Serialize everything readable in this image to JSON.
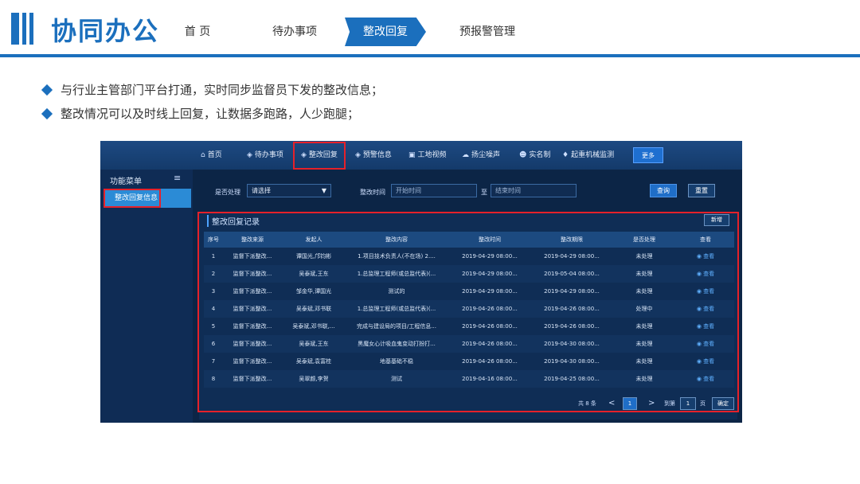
{
  "slide": {
    "title": "协同办公",
    "nav": [
      {
        "label": "首 页"
      },
      {
        "label": "待办事项"
      },
      {
        "label": "整改回复"
      },
      {
        "label": "预报警管理"
      }
    ],
    "bullets": [
      "与行业主管部门平台打通，实时同步监督员下发的整改信息；",
      "整改情况可以及时线上回复，让数据多跑路，人少跑腿；"
    ]
  },
  "app": {
    "topnav": [
      {
        "label": "首页",
        "icon": "home-icon",
        "glyph": "⌂"
      },
      {
        "label": "待办事项",
        "icon": "shield-icon",
        "glyph": "◈"
      },
      {
        "label": "整改回复",
        "icon": "shield-icon",
        "glyph": "◈"
      },
      {
        "label": "预警信息",
        "icon": "shield-icon",
        "glyph": "◈"
      },
      {
        "label": "工地视频",
        "icon": "video-icon",
        "glyph": "▣"
      },
      {
        "label": "扬尘噪声",
        "icon": "cloud-icon",
        "glyph": "☁"
      },
      {
        "label": "实名制",
        "icon": "people-icon",
        "glyph": "☻"
      },
      {
        "label": "起重机械监测",
        "icon": "crane-icon",
        "glyph": "♦"
      }
    ],
    "more_label": "更多",
    "sidebar": {
      "title": "功能菜单",
      "menu_glyph": "≡",
      "item": "整改回复信息"
    },
    "filter": {
      "status_label": "是否处理",
      "status_value": "请选择",
      "status_arrow": "▼",
      "time_label": "整改时间",
      "start_placeholder": "开始时间",
      "to": "至",
      "end_placeholder": "结束时间",
      "query": "查询",
      "reset": "重置"
    },
    "panel": {
      "title": "整改回复记录",
      "add": "新增"
    },
    "table": {
      "headers": [
        "序号",
        "整改来源",
        "发起人",
        "整改内容",
        "整改时间",
        "整改期限",
        "是否处理",
        "查看"
      ],
      "rows": [
        [
          "1",
          "监督下派整改...",
          "谭国光,邝钧彬",
          "1.项目技术负责人(不在场) 2....",
          "2019-04-29 08:00...",
          "2019-04-29 08:00...",
          "未处理",
          "查看"
        ],
        [
          "2",
          "监督下派整改...",
          "吴泰斌,王东",
          "1.总监理工程师(或总监代表)(...",
          "2019-04-29 08:00...",
          "2019-05-04 08:00...",
          "未处理",
          "查看"
        ],
        [
          "3",
          "监督下派整改...",
          "邹金华,谭国光",
          "测试的",
          "2019-04-29 08:00...",
          "2019-04-29 08:00...",
          "未处理",
          "查看"
        ],
        [
          "4",
          "监督下派整改...",
          "吴泰斌,邓书联",
          "1.总监理工程师(或总监代表)(...",
          "2019-04-26 08:00...",
          "2019-04-26 08:00...",
          "处理中",
          "查看"
        ],
        [
          "5",
          "监督下派整改...",
          "吴泰斌,邓书联,...",
          "完成与建设局的项目/工程信息...",
          "2019-04-26 08:00...",
          "2019-04-26 08:00...",
          "未处理",
          "查看"
        ],
        [
          "6",
          "监督下派整改...",
          "吴泰斌,王东",
          "黑魔女心计吸血鬼变动打扮打...",
          "2019-04-26 08:00...",
          "2019-04-30 08:00...",
          "未处理",
          "查看"
        ],
        [
          "7",
          "监督下派整改...",
          "吴泰斌,袁富桂",
          "地基基础不稳",
          "2019-04-26 08:00...",
          "2019-04-30 08:00...",
          "未处理",
          "查看"
        ],
        [
          "8",
          "监督下派整改...",
          "吴翠颜,李贺",
          "测试",
          "2019-04-16 08:00...",
          "2019-04-25 08:00...",
          "未处理",
          "查看"
        ]
      ]
    },
    "pager": {
      "total": "共 8 条",
      "prev": "<",
      "page": "1",
      "next": ">",
      "goto": "到第",
      "goto_value": "1",
      "page_unit": "页",
      "confirm": "确定"
    }
  }
}
